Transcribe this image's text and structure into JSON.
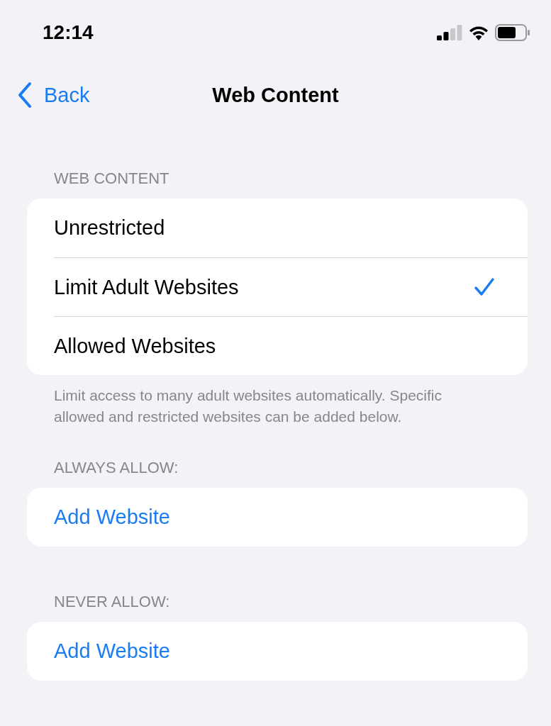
{
  "status_bar": {
    "time": "12:14"
  },
  "nav": {
    "back": "Back",
    "title": "Web Content"
  },
  "sections": [
    {
      "header": "WEB CONTENT",
      "rows": [
        {
          "label": "Unrestricted",
          "kind": "option",
          "selected": false
        },
        {
          "label": "Limit Adult Websites",
          "kind": "option",
          "selected": true
        },
        {
          "label": "Allowed Websites",
          "kind": "option",
          "selected": false
        }
      ],
      "footer": "Limit access to many adult websites automatically. Specific allowed and restricted websites can be added below."
    },
    {
      "header": "ALWAYS ALLOW:",
      "rows": [
        {
          "label": "Add Website",
          "kind": "action"
        }
      ]
    },
    {
      "header": "NEVER ALLOW:",
      "rows": [
        {
          "label": "Add Website",
          "kind": "action"
        }
      ]
    }
  ]
}
